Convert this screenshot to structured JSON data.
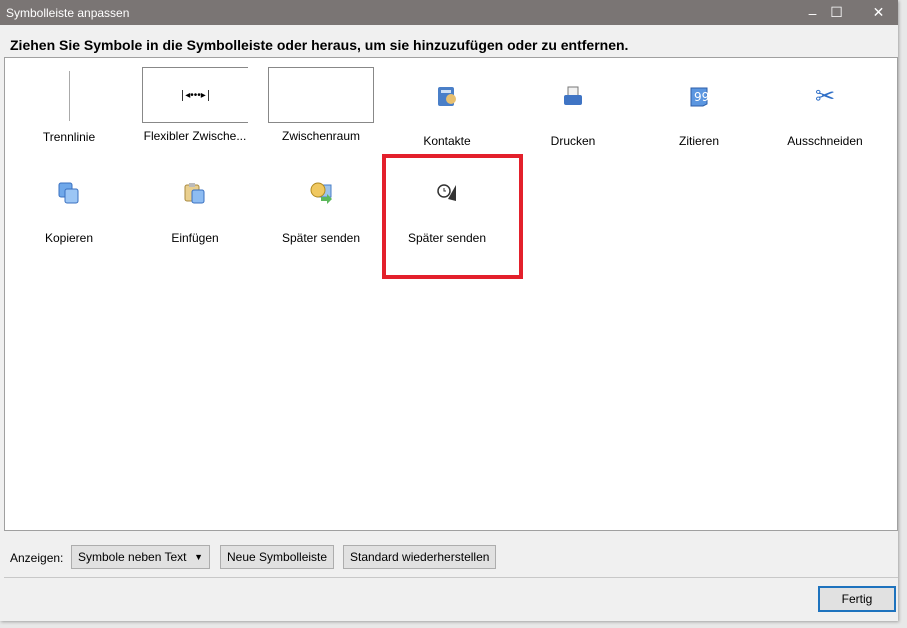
{
  "window": {
    "title": "Symbolleiste anpassen",
    "minimize": "–",
    "maximize": "☐",
    "close": "✕"
  },
  "instruction": "Ziehen Sie Symbole in die Symbolleiste oder heraus, um sie hinzuzufügen oder zu entfernen.",
  "items": [
    {
      "label": "Trennlinie",
      "icon": "separator-icon"
    },
    {
      "label": "Flexibler Zwische...",
      "icon": "flexible-space-icon"
    },
    {
      "label": "Zwischenraum",
      "icon": "space-icon"
    },
    {
      "label": "Kontakte",
      "icon": "contacts-icon"
    },
    {
      "label": "Drucken",
      "icon": "print-icon"
    },
    {
      "label": "Zitieren",
      "icon": "quote-icon"
    },
    {
      "label": "Ausschneiden",
      "icon": "scissors-icon"
    },
    {
      "label": "Kopieren",
      "icon": "copy-icon"
    },
    {
      "label": "Einfügen",
      "icon": "paste-icon"
    },
    {
      "label": "Später senden",
      "icon": "send-later-icon"
    },
    {
      "label": "Später senden",
      "icon": "send-later-clock-icon"
    }
  ],
  "footer": {
    "show_label": "Anzeigen:",
    "show_value": "Symbole neben Text",
    "new_toolbar": "Neue Symbolleiste",
    "restore_default": "Standard wiederherstellen",
    "done": "Fertig"
  },
  "colors": {
    "highlight": "#e3202b",
    "titlebar": "#7a7574"
  }
}
